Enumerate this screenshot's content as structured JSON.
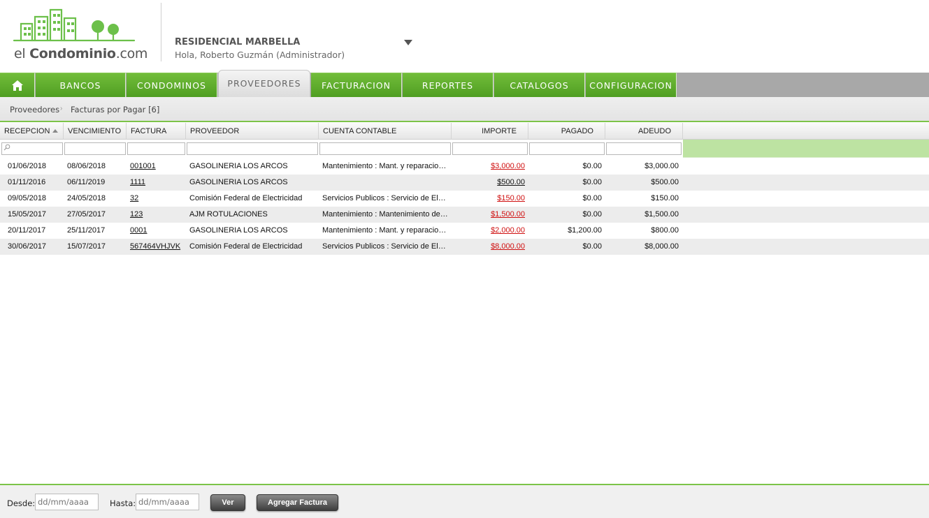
{
  "brand": {
    "logo_prefix": "el ",
    "logo_bold": "Condominio",
    "logo_suffix": ".com"
  },
  "header": {
    "condo_name": "RESIDENCIAL MARBELLA",
    "greeting": "Hola, Roberto Guzmán (Administrador)"
  },
  "nav": {
    "items": [
      {
        "label": "BANCOS"
      },
      {
        "label": "CONDOMINOS"
      },
      {
        "label": "PROVEEDORES"
      },
      {
        "label": "FACTURACION"
      },
      {
        "label": "REPORTES"
      },
      {
        "label": "CATALOGOS"
      },
      {
        "label": "CONFIGURACION"
      }
    ],
    "active": "PROVEEDORES"
  },
  "breadcrumb": {
    "root": "Proveedores",
    "current": "Facturas por Pagar [6]"
  },
  "grid": {
    "columns": [
      "RECEPCION",
      "VENCIMIENTO",
      "FACTURA",
      "PROVEEDOR",
      "CUENTA CONTABLE",
      "IMPORTE",
      "PAGADO",
      "ADEUDO"
    ],
    "sorted_by": "RECEPCION",
    "rows": [
      {
        "recepcion": "01/06/2018",
        "vencimiento": "08/06/2018",
        "factura": "001001",
        "proveedor": "GASOLINERIA LOS ARCOS",
        "cuenta": "Mantenimiento : Mant. y reparacion de vehiculos",
        "importe": "$3,000.00",
        "pagado": "$0.00",
        "adeudo": "$3,000.00",
        "overdue": true
      },
      {
        "recepcion": "01/11/2016",
        "vencimiento": "06/11/2019",
        "factura": "1111",
        "proveedor": "GASOLINERIA LOS ARCOS",
        "cuenta": "",
        "importe": "$500.00",
        "pagado": "$0.00",
        "adeudo": "$500.00",
        "overdue": false
      },
      {
        "recepcion": "09/05/2018",
        "vencimiento": "24/05/2018",
        "factura": "32",
        "proveedor": "Comisión Federal de Electricidad",
        "cuenta": "Servicios Publicos : Servicio de Electricidad",
        "importe": "$150.00",
        "pagado": "$0.00",
        "adeudo": "$150.00",
        "overdue": true
      },
      {
        "recepcion": "15/05/2017",
        "vencimiento": "27/05/2017",
        "factura": "123",
        "proveedor": "AJM ROTULACIONES",
        "cuenta": "Mantenimiento : Mantenimiento de Edificio",
        "importe": "$1,500.00",
        "pagado": "$0.00",
        "adeudo": "$1,500.00",
        "overdue": true
      },
      {
        "recepcion": "20/11/2017",
        "vencimiento": "25/11/2017",
        "factura": "0001",
        "proveedor": "GASOLINERIA LOS ARCOS",
        "cuenta": "Mantenimiento : Mant. y reparacion de vehiculos",
        "importe": "$2,000.00",
        "pagado": "$1,200.00",
        "adeudo": "$800.00",
        "overdue": true
      },
      {
        "recepcion": "30/06/2017",
        "vencimiento": "15/07/2017",
        "factura": "567464VHJVK",
        "proveedor": "Comisión Federal de Electricidad",
        "cuenta": "Servicios Publicos : Servicio de Electricidad",
        "importe": "$8,000.00",
        "pagado": "$0.00",
        "adeudo": "$8,000.00",
        "overdue": true
      }
    ]
  },
  "footer": {
    "desde_label": "Desde:",
    "desde_placeholder": "dd/mm/aaaa",
    "hasta_label": "Hasta:",
    "hasta_placeholder": "dd/mm/aaaa",
    "ver_label": "Ver",
    "agregar_label": "Agregar Factura"
  },
  "colors": {
    "brand_green": "#5aab2a",
    "overdue_red": "#d01010",
    "filter_green": "#bde3a2"
  },
  "icons": {
    "home": "home-icon",
    "dropdown": "chevron-down-icon",
    "search": "search-icon",
    "sort": "sort-asc-icon"
  }
}
